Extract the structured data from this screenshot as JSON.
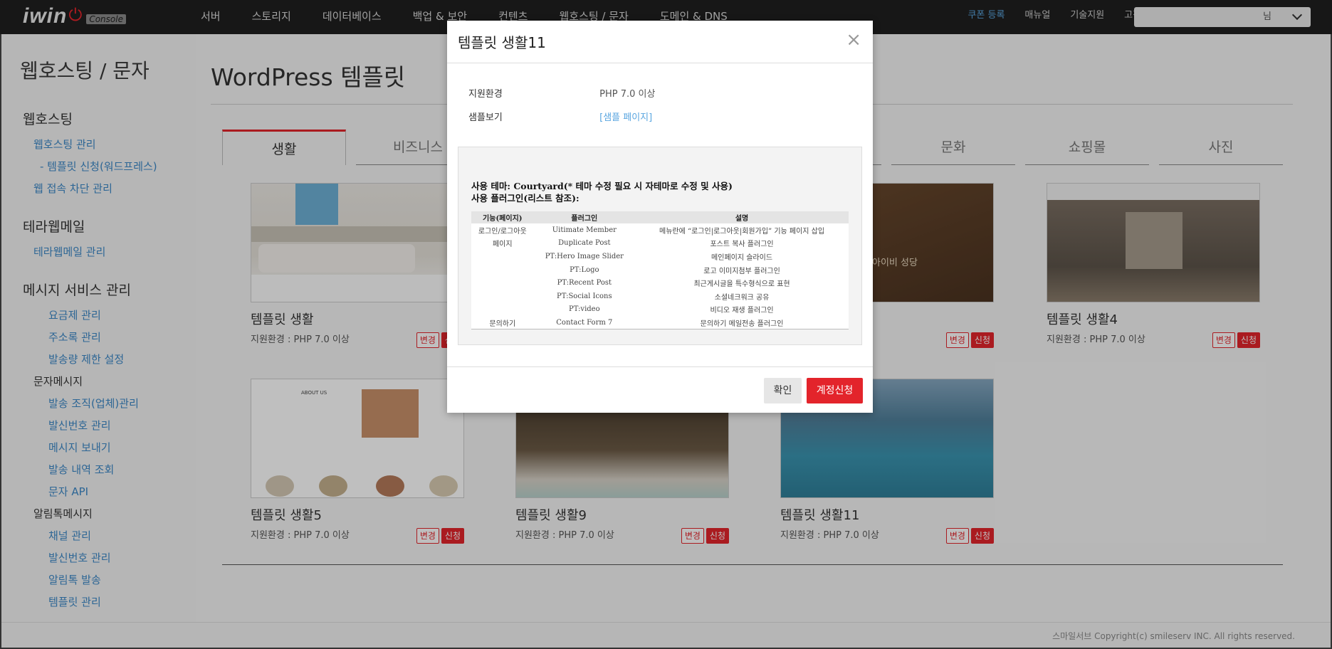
{
  "app": {
    "logo": "iwin",
    "logo_badge": "Console"
  },
  "topnav": {
    "items": [
      "서버",
      "스토리지",
      "데이터베이스",
      "백업 & 보안",
      "컨텐츠",
      "웹호스팅 / 문자",
      "도메인 & DNS"
    ],
    "utility": [
      "쿠폰 등록",
      "매뉴얼",
      "기술지원",
      "고객지원"
    ],
    "user_name": "님"
  },
  "sidebar": {
    "title": "웹호스팅 / 문자",
    "sections": [
      {
        "heading": "웹호스팅",
        "links": [
          "웹호스팅 관리",
          "- 템플릿 신청(워드프레스)",
          "웹 접속 차단 관리"
        ]
      },
      {
        "heading": "테라웹메일",
        "links": [
          "테라웹메일 관리"
        ]
      },
      {
        "heading": "메시지 서비스 관리",
        "links": [
          "요금제 관리",
          "주소록 관리",
          "발송량 제한 설정"
        ]
      },
      {
        "subheading": "문자메시지",
        "links": [
          "발송 조직(업체)관리",
          "발신번호 관리",
          "메시지 보내기",
          "발송 내역 조회",
          "문자 API"
        ]
      },
      {
        "subheading": "알림톡메시지",
        "links": [
          "채널 관리",
          "발신번호 관리",
          "알림톡 발송",
          "템플릿 관리"
        ]
      }
    ]
  },
  "main": {
    "title": "WordPress 템플릿",
    "tabs": [
      "생활",
      "비즈니스",
      "",
      "",
      "",
      "문화",
      "쇼핑몰",
      "사진"
    ],
    "cards": [
      {
        "title": "템플릿 생활",
        "env": "지원환경 : PHP 7.0 이상"
      },
      {
        "title": "",
        "env": ""
      },
      {
        "title": "",
        "env": "",
        "overlay_text": "아이비 성당"
      },
      {
        "title": "템플릿 생활4",
        "env": "지원환경 : PHP 7.0 이상"
      },
      {
        "title": "템플릿 생활5",
        "env": "지원환경 : PHP 7.0 이상",
        "thumb_heading": "ABOUT US"
      },
      {
        "title": "템플릿 생활9",
        "env": "지원환경 : PHP 7.0 이상"
      },
      {
        "title": "템플릿 생활11",
        "env": "지원환경 : PHP 7.0 이상"
      }
    ],
    "badge_change": "변경",
    "badge_apply": "신청"
  },
  "footer": {
    "copyright": "스마일서브 Copyright(c) smileserv INC. All rights reserved."
  },
  "modal": {
    "title": "템플릿 생활11",
    "env_label": "지원환경",
    "env_value": "PHP 7.0 이상",
    "sample_label": "샘플보기",
    "sample_link": "[샘플 페이지]",
    "theme_line": "사용 테마: Courtyard(* 테마 수정 필요 시 자테마로 수정 및 사용)",
    "plugin_line": "사용 플러그인(리스트 참조):",
    "table_headers": [
      "기능(페이지)",
      "플러그인",
      "설명"
    ],
    "table_rows": [
      [
        "로그인/로그아웃",
        "Uitimate Member",
        "메뉴란에 “로그인|로그아웃|회원가입” 기능 페이지 삽입"
      ],
      [
        "페이지",
        "Duplicate Post",
        "포스트 복사 플러그인"
      ],
      [
        "",
        "PT:Hero Image Slider",
        "메인페이지 슬라이드"
      ],
      [
        "",
        "PT:Logo",
        "로고 이미지첨부 플러그인"
      ],
      [
        "",
        "PT:Recent Post",
        "최근게시글을 특수형식으로 표현"
      ],
      [
        "",
        "PT:Social Icons",
        "소셜네크워크 공유"
      ],
      [
        "",
        "PT:video",
        "비디오 재생 플러그인"
      ],
      [
        "문의하기",
        "Contact Form 7",
        "문의하기 메일전송 플러그인"
      ]
    ],
    "btn_ok": "확인",
    "btn_request": "계정신청"
  },
  "colors": {
    "accent": "#e3242b",
    "link": "#3c88c7",
    "nav_bg": "#1f1f1f"
  }
}
